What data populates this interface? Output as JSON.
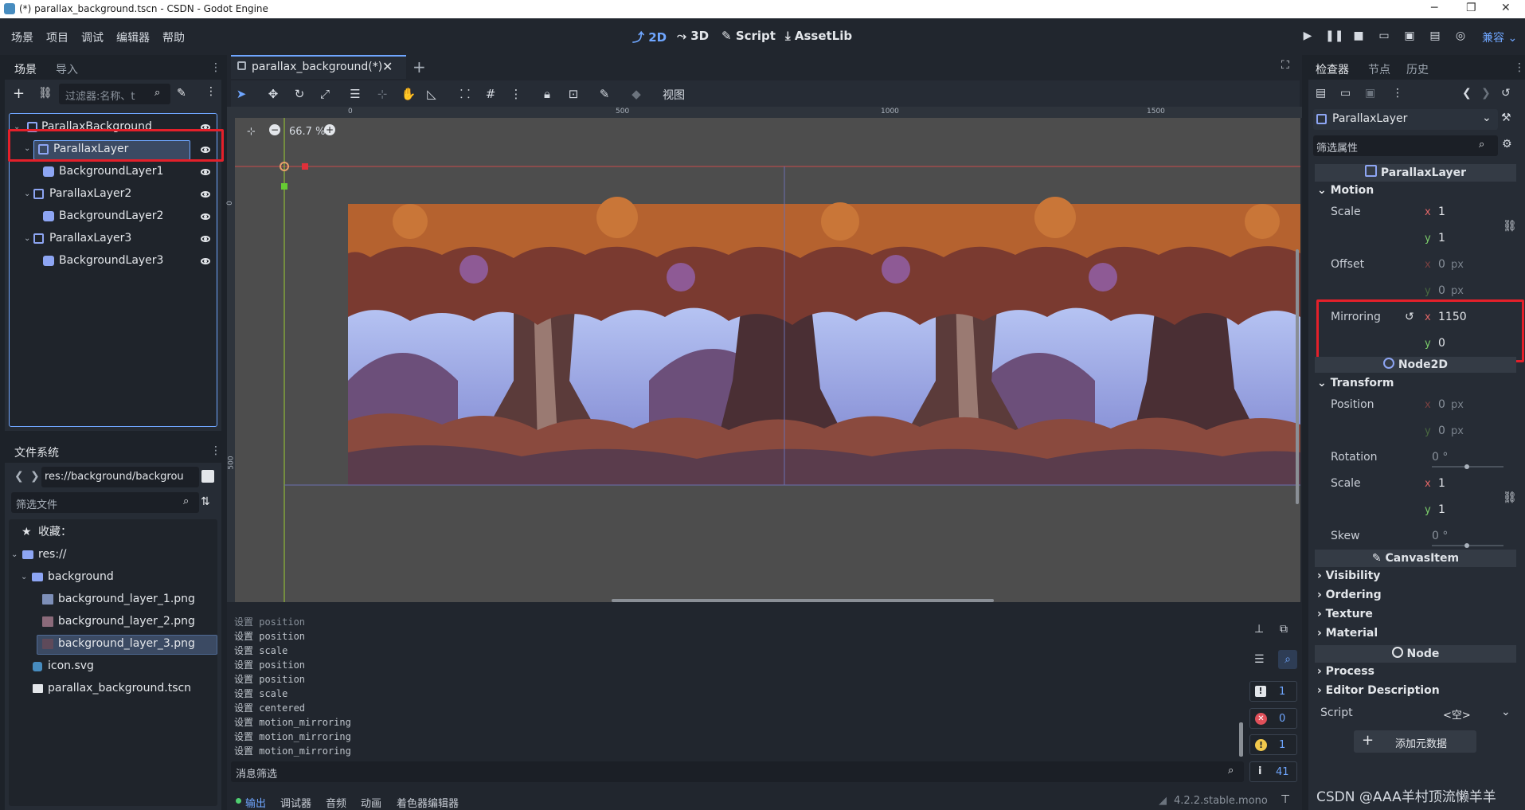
{
  "window": {
    "title": "(*) parallax_background.tscn - CSDN - Godot Engine",
    "controls": [
      "─",
      "❐",
      "✕"
    ]
  },
  "menubar": {
    "menus": [
      "场景",
      "项目",
      "调试",
      "编辑器",
      "帮助"
    ],
    "workspaces": [
      "2D",
      "3D",
      "Script",
      "AssetLib"
    ],
    "active_workspace": "2D",
    "renderer": "兼容"
  },
  "scene_dock": {
    "tabs": [
      "场景",
      "导入"
    ],
    "filter_placeholder": "过滤器:名称、t",
    "tree": [
      {
        "label": "ParallaxBackground",
        "depth": 0,
        "type": "node",
        "selected": false
      },
      {
        "label": "ParallaxLayer",
        "depth": 1,
        "type": "node",
        "selected": true,
        "highlighted": true
      },
      {
        "label": "BackgroundLayer1",
        "depth": 2,
        "type": "sprite",
        "selected": false
      },
      {
        "label": "ParallaxLayer2",
        "depth": 1,
        "type": "node",
        "selected": false
      },
      {
        "label": "BackgroundLayer2",
        "depth": 2,
        "type": "sprite",
        "selected": false
      },
      {
        "label": "ParallaxLayer3",
        "depth": 1,
        "type": "node",
        "selected": false
      },
      {
        "label": "BackgroundLayer3",
        "depth": 2,
        "type": "sprite",
        "selected": false
      }
    ]
  },
  "filesystem_dock": {
    "title": "文件系统",
    "path": "res://background/backgrou",
    "filter_placeholder": "筛选文件",
    "items": [
      {
        "label": "收藏：",
        "icon": "star-icon"
      },
      {
        "label": "res://",
        "icon": "folder-icon"
      },
      {
        "label": "background",
        "icon": "folder-icon"
      },
      {
        "label": "background_layer_1.png",
        "icon": "image-icon"
      },
      {
        "label": "background_layer_2.png",
        "icon": "image-icon"
      },
      {
        "label": "background_layer_3.png",
        "icon": "image-icon",
        "selected": true
      },
      {
        "label": "icon.svg",
        "icon": "godot-icon"
      },
      {
        "label": "parallax_background.tscn",
        "icon": "scene-icon"
      }
    ]
  },
  "editor": {
    "scene_tab": "parallax_background(*)",
    "view_menu": "视图",
    "zoom": "66.7 %",
    "ruler_labels": [
      "0",
      "500",
      "1000",
      "1500"
    ],
    "vruler_labels": [
      "0",
      "500"
    ]
  },
  "output": {
    "lines": [
      "设置 position",
      "设置 position",
      "设置 scale",
      "设置 position",
      "设置 position",
      "设置 scale",
      "设置 centered",
      "设置 motion_mirroring",
      "设置 motion_mirroring",
      "设置 motion_mirroring"
    ],
    "filter_placeholder": "消息筛选",
    "counts": {
      "messages": "1",
      "errors": "0",
      "warnings": "1",
      "info": "41"
    },
    "bottom_tabs": [
      "输出",
      "调试器",
      "音频",
      "动画",
      "着色器编辑器"
    ],
    "version": "4.2.2.stable.mono"
  },
  "inspector": {
    "tabs": [
      "检查器",
      "节点",
      "历史"
    ],
    "node_name": "ParallaxLayer",
    "filter_placeholder": "筛选属性",
    "class_header": "ParallaxLayer",
    "motion_group": "Motion",
    "scale_label": "Scale",
    "scale_x": "1",
    "scale_y": "1",
    "offset_label": "Offset",
    "offset_x": "0",
    "offset_y": "0",
    "unit_px": "px",
    "mirroring_label": "Mirroring",
    "mirroring_x": "1150",
    "mirroring_y": "0",
    "node2d_header": "Node2D",
    "transform_group": "Transform",
    "position_label": "Position",
    "position_x": "0",
    "position_y": "0",
    "rotation_label": "Rotation",
    "rotation_val": "0 °",
    "t_scale_label": "Scale",
    "t_scale_x": "1",
    "t_scale_y": "1",
    "skew_label": "Skew",
    "skew_val": "0 °",
    "canvasitem_header": "CanvasItem",
    "groups": [
      "Visibility",
      "Ordering",
      "Texture",
      "Material"
    ],
    "node_header": "Node",
    "node_groups": [
      "Process",
      "Editor Description"
    ],
    "script_label": "Script",
    "script_val": "<空>",
    "add_metadata": "添加元数据"
  },
  "watermark": "CSDN @AAA羊村顶流懒羊羊",
  "colors": {
    "accent": "#6fa6ff",
    "highlight": "#e4202a",
    "node_icon": "#8da5f3"
  }
}
